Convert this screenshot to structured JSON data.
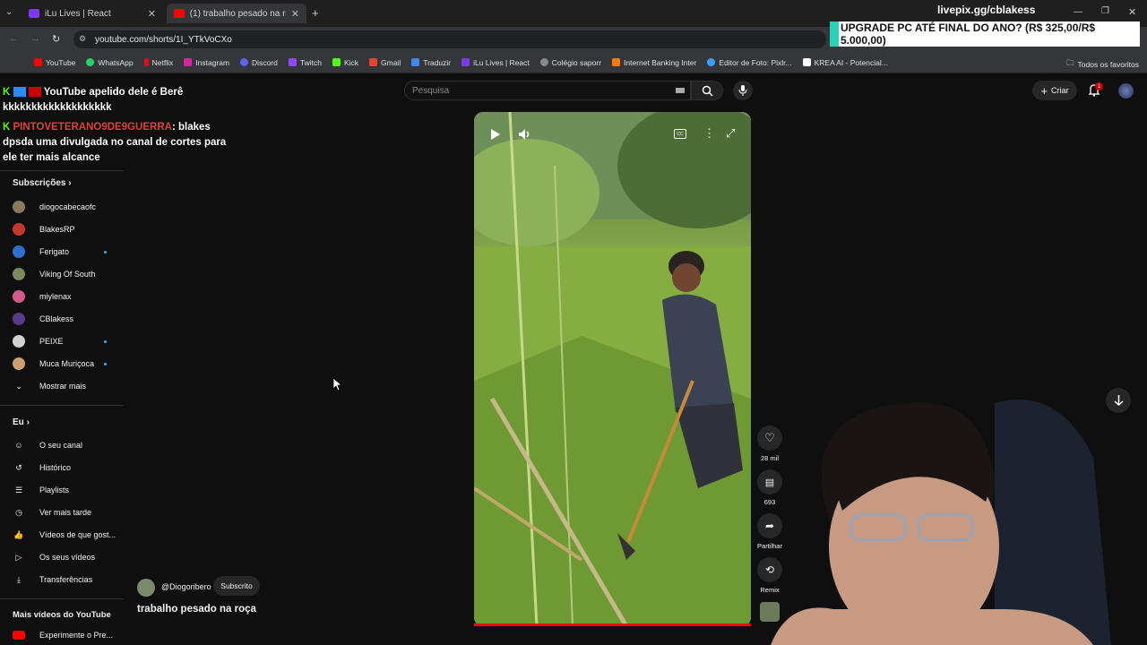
{
  "browser": {
    "tabs": [
      {
        "title": "iLu Lives | React",
        "color": "#7c3aed"
      },
      {
        "title": "(1) trabalho pesado na roça - Yo",
        "color": "#ff0000"
      }
    ],
    "url": "youtube.com/shorts/1I_YTkVoCXo",
    "bookmarks": [
      "YouTube",
      "WhatsApp",
      "Netflix",
      "Instagram",
      "Discord",
      "Twitch",
      "Kick",
      "Gmail",
      "Traduzir",
      "iLu Lives | React",
      "Colégio saporr",
      "Internet Banking Inter",
      "Editor de Foto: Pixlr...",
      "KREA AI - Potencial..."
    ],
    "all_bookmarks": "Todos os favoritos"
  },
  "overlay": {
    "livepix": "livepix.gg/cblakess",
    "upgrade": "UPGRADE PC ATÉ FINAL DO ANO? (R$ 325,00/R$ 5.000,00)"
  },
  "chat": {
    "line1": "YouTube apelido dele é Berê",
    "line2": "kkkkkkkkkkkkkkkkkkk",
    "user2": "PINTOVETERANO9DE9GUERRA",
    "msg2a": ": blakes",
    "msg2b": "dpsda uma divulgada no canal de cortes para",
    "msg2c": "ele ter mais alcance"
  },
  "youtube": {
    "search_placeholder": "Pesquisa",
    "create": "Criar",
    "notif_count": "1",
    "subs_title": "Subscrições",
    "subs": [
      {
        "name": "diogocabecaofc",
        "color": "#8a7a5a",
        "live": false
      },
      {
        "name": "BlakesRP",
        "color": "#c0392b",
        "live": false
      },
      {
        "name": "Ferigato",
        "color": "#2c6fd1",
        "live": true
      },
      {
        "name": "Viking Of South",
        "color": "#7a8a5a",
        "live": false
      },
      {
        "name": "miylenax",
        "color": "#d05a8a",
        "live": false
      },
      {
        "name": "CBlakess",
        "color": "#5a3a8a",
        "live": false
      },
      {
        "name": "PEIXE",
        "color": "#d0d0d0",
        "live": true
      },
      {
        "name": "Muca Muriçoca",
        "color": "#caa070",
        "live": true
      }
    ],
    "show_more": "Mostrar mais",
    "you_title": "Eu",
    "you_items": [
      "O seu canal",
      "Histórico",
      "Playlists",
      "Ver mais tarde",
      "Vídeos de que gost...",
      "Os seus vídeos",
      "Transferências"
    ],
    "more_title": "Mais vídeos do YouTube",
    "more_item": "Experimente o Pre...",
    "channel": "@Diogoribero",
    "subscribed": "Subscrito",
    "video_title": "trabalho pesado na roça",
    "likes": "28 mil",
    "comments": "693",
    "share": "Partilhar",
    "remix": "Remix"
  }
}
